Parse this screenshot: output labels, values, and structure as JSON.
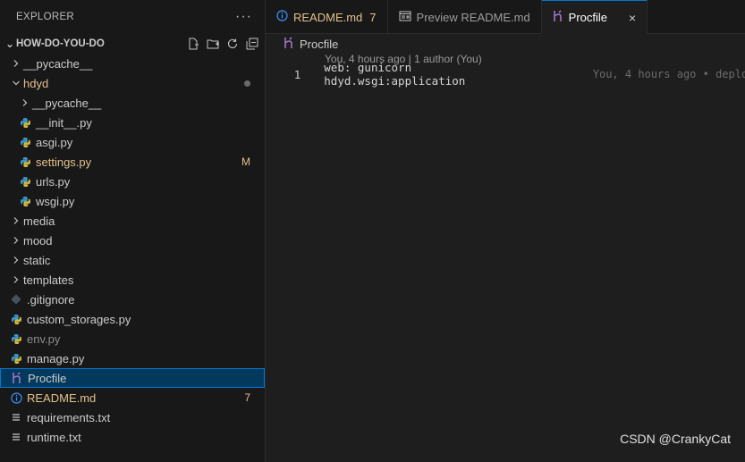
{
  "explorer": {
    "title": "EXPLORER",
    "more": "···",
    "project": "HOW-DO-YOU-DO",
    "actions": [
      "new-file-icon",
      "new-folder-icon",
      "refresh-icon",
      "collapse-all-icon"
    ]
  },
  "tree": [
    {
      "label": "__pycache__",
      "indent": 0,
      "type": "folder",
      "expanded": false
    },
    {
      "label": "hdyd",
      "indent": 0,
      "type": "folder",
      "expanded": true,
      "status": "modified",
      "decoration": "dot"
    },
    {
      "label": "__pycache__",
      "indent": 1,
      "type": "folder",
      "expanded": false
    },
    {
      "label": "__init__.py",
      "indent": 1,
      "type": "python"
    },
    {
      "label": "asgi.py",
      "indent": 1,
      "type": "python"
    },
    {
      "label": "settings.py",
      "indent": 1,
      "type": "python",
      "status": "modified",
      "decoration": "M"
    },
    {
      "label": "urls.py",
      "indent": 1,
      "type": "python"
    },
    {
      "label": "wsgi.py",
      "indent": 1,
      "type": "python"
    },
    {
      "label": "media",
      "indent": 0,
      "type": "folder",
      "expanded": false
    },
    {
      "label": "mood",
      "indent": 0,
      "type": "folder",
      "expanded": false
    },
    {
      "label": "static",
      "indent": 0,
      "type": "folder",
      "expanded": false
    },
    {
      "label": "templates",
      "indent": 0,
      "type": "folder",
      "expanded": false
    },
    {
      "label": ".gitignore",
      "indent": 0,
      "type": "git"
    },
    {
      "label": "custom_storages.py",
      "indent": 0,
      "type": "python"
    },
    {
      "label": "env.py",
      "indent": 0,
      "type": "python",
      "status": "ignored"
    },
    {
      "label": "manage.py",
      "indent": 0,
      "type": "python"
    },
    {
      "label": "Procfile",
      "indent": 0,
      "type": "heroku",
      "selected": true
    },
    {
      "label": "README.md",
      "indent": 0,
      "type": "info",
      "status": "modified",
      "decoration": "7"
    },
    {
      "label": "requirements.txt",
      "indent": 0,
      "type": "text"
    },
    {
      "label": "runtime.txt",
      "indent": 0,
      "type": "text"
    }
  ],
  "tabs": [
    {
      "label": "README.md",
      "count": "7",
      "icon": "info-icon",
      "active": false
    },
    {
      "label": "Preview README.md",
      "icon": "preview-icon",
      "active": false
    },
    {
      "label": "Procfile",
      "icon": "heroku-icon",
      "active": true,
      "close": "×"
    }
  ],
  "editor": {
    "breadcrumb": "Procfile",
    "codelens": "You, 4 hours ago | 1 author (You)",
    "line_number": "1",
    "code": "web: gunicorn hdyd.wsgi:application",
    "blame": "You, 4 hours ago • deplo"
  },
  "watermark": "CSDN @CrankyCat",
  "colors": {
    "modified": "#e2c08d",
    "python": "#3c9ad0",
    "heroku": "#a074c4",
    "info": "#3794ff",
    "selected_bg": "#04395e",
    "selected_border": "#0078d4"
  }
}
